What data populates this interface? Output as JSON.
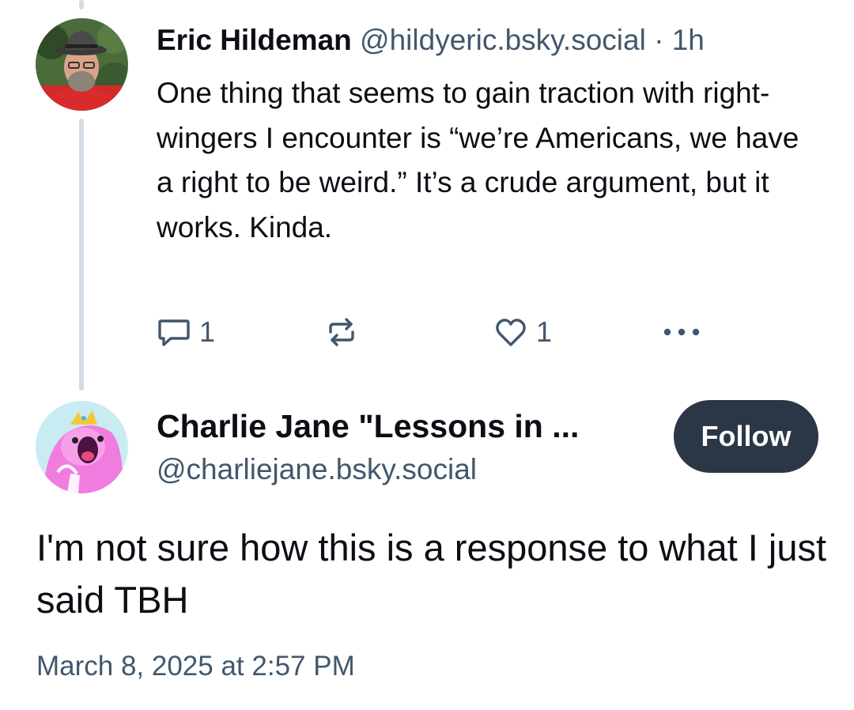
{
  "parent_post": {
    "author_name": "Eric Hildeman",
    "author_handle": "@hildyeric.bsky.social",
    "separator": "·",
    "age": "1h",
    "text": "One thing that seems to gain traction with right-wingers I encounter is “we’re Americans, we have a right to be weird.” It’s a crude argument, but it works. Kinda.",
    "reply_count": "1",
    "like_count": "1"
  },
  "reply_post": {
    "author_name": "Charlie Jane \"Lessons in ...",
    "author_handle": "@charliejane.bsky.social",
    "follow_label": "Follow",
    "text": "I'm not sure how this is a response to what I just said TBH",
    "timestamp": "March 8, 2025 at 2:57 PM"
  },
  "icons": {
    "reply": "speech-bubble-icon",
    "repost": "repost-arrows-icon",
    "like": "heart-icon",
    "more": "ellipsis-icon"
  },
  "colors": {
    "text_primary": "#0b0f14",
    "text_secondary": "#42576c",
    "thread_line": "#d4dbe2",
    "follow_button_bg": "#2b3747",
    "follow_button_text": "#ffffff"
  }
}
